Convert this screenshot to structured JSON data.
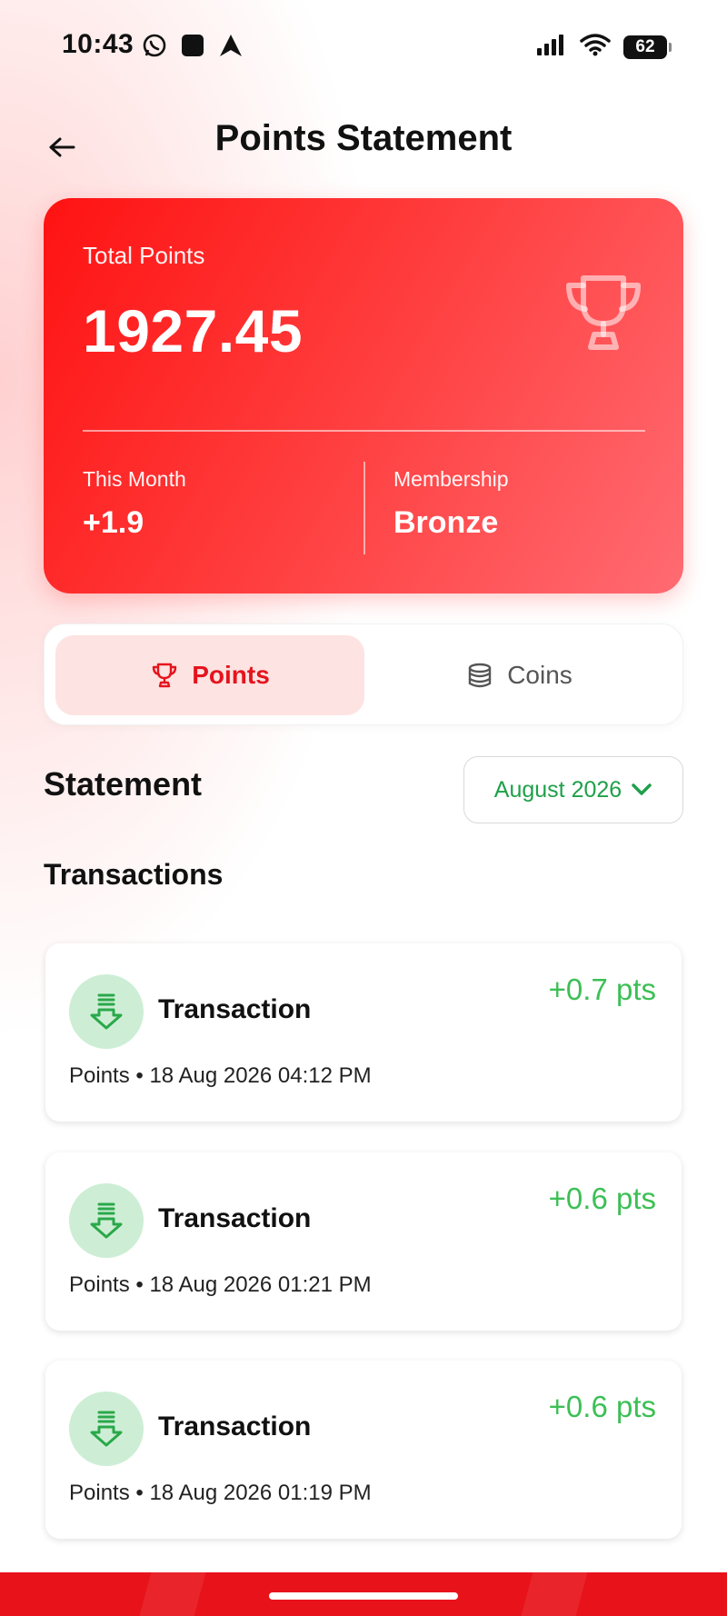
{
  "status_bar": {
    "time": "10:43",
    "battery": "62",
    "icons": [
      "whatsapp-icon",
      "square-app-icon",
      "arrow-app-icon",
      "signal-icon",
      "wifi-icon",
      "battery-icon"
    ]
  },
  "header": {
    "title": "Points Statement",
    "back_icon": "arrow-left-icon"
  },
  "summary": {
    "total_label": "Total Points",
    "total_value": "1927.45",
    "this_month_label": "This Month",
    "this_month_value": "+1.9",
    "membership_label": "Membership",
    "membership_value": "Bronze",
    "icon": "trophy-icon"
  },
  "tabs": [
    {
      "label": "Points",
      "icon": "trophy-icon",
      "active": true
    },
    {
      "label": "Coins",
      "icon": "coins-icon",
      "active": false
    }
  ],
  "statement": {
    "title": "Statement",
    "month": "August 2026"
  },
  "transactions_title": "Transactions",
  "transactions": [
    {
      "title": "Transaction",
      "amount": "+0.7 pts",
      "meta": "Points • 18 Aug 2026 04:12 PM"
    },
    {
      "title": "Transaction",
      "amount": "+0.6 pts",
      "meta": "Points • 18 Aug 2026 01:21 PM"
    },
    {
      "title": "Transaction",
      "amount": "+0.6 pts",
      "meta": "Points • 18 Aug 2026 01:19 PM"
    }
  ],
  "colors": {
    "brand_red": "#e5141d",
    "card_gradient_start": "#ff1212",
    "card_gradient_end": "#ff6b72",
    "positive_green": "#3cbf55",
    "select_green": "#1fa04a",
    "icon_bg_green": "#cdeed5",
    "active_tab_bg": "#fde3e1"
  }
}
